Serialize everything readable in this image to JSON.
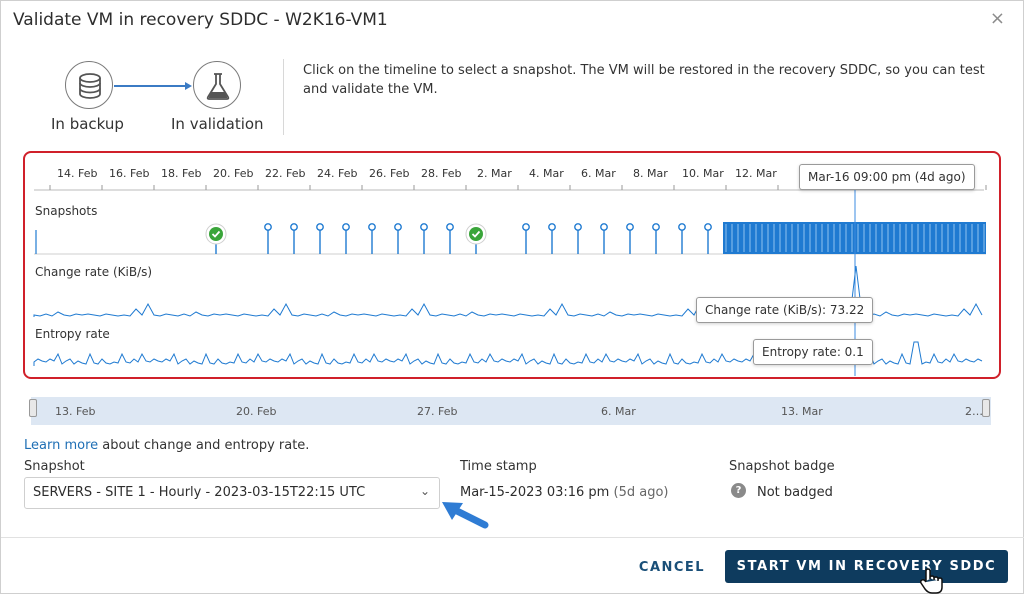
{
  "dialog": {
    "title": "Validate VM in recovery SDDC - W2K16-VM1",
    "close_glyph": "×"
  },
  "steps": [
    {
      "icon": "database-icon",
      "label": "In backup"
    },
    {
      "icon": "flask-icon",
      "label": "In validation"
    }
  ],
  "instructions": "Click on the timeline to select a snapshot. The VM will be restored in the recovery SDDC, so you can test and validate the VM.",
  "timeline": {
    "dates": [
      "14. Feb",
      "16. Feb",
      "18. Feb",
      "20. Feb",
      "22. Feb",
      "24. Feb",
      "26. Feb",
      "28. Feb",
      "2. Mar",
      "4. Mar",
      "6. Mar",
      "8. Mar",
      "10. Mar",
      "12. Mar"
    ],
    "rows": {
      "snapshots": "Snapshots",
      "change_rate": "Change rate (KiB/s)",
      "entropy_rate": "Entropy rate"
    },
    "tooltip_time": "Mar-16 09:00 pm (4d ago)",
    "tooltip_change_rate": "Change rate (KiB/s): 73.22",
    "tooltip_entropy_rate": "Entropy rate: 0.1",
    "accent_color": "#1f7ad1",
    "highlight_border_color": "#d0202a"
  },
  "overview": {
    "labels": [
      "13. Feb",
      "20. Feb",
      "27. Feb",
      "6. Mar",
      "13. Mar",
      "2…"
    ]
  },
  "learn_more": {
    "link": "Learn more",
    "text": " about change and entropy rate."
  },
  "snapshot": {
    "label": "Snapshot",
    "selected": "SERVERS - SITE 1 - Hourly - 2023-03-15T22:15 UTC"
  },
  "timestamp": {
    "label": "Time stamp",
    "value": "Mar-15-2023 03:16 pm",
    "relative": "(5d ago)"
  },
  "badge": {
    "label": "Snapshot badge",
    "value": "Not badged"
  },
  "footer": {
    "cancel": "CANCEL",
    "start": "START VM IN RECOVERY SDDC"
  }
}
